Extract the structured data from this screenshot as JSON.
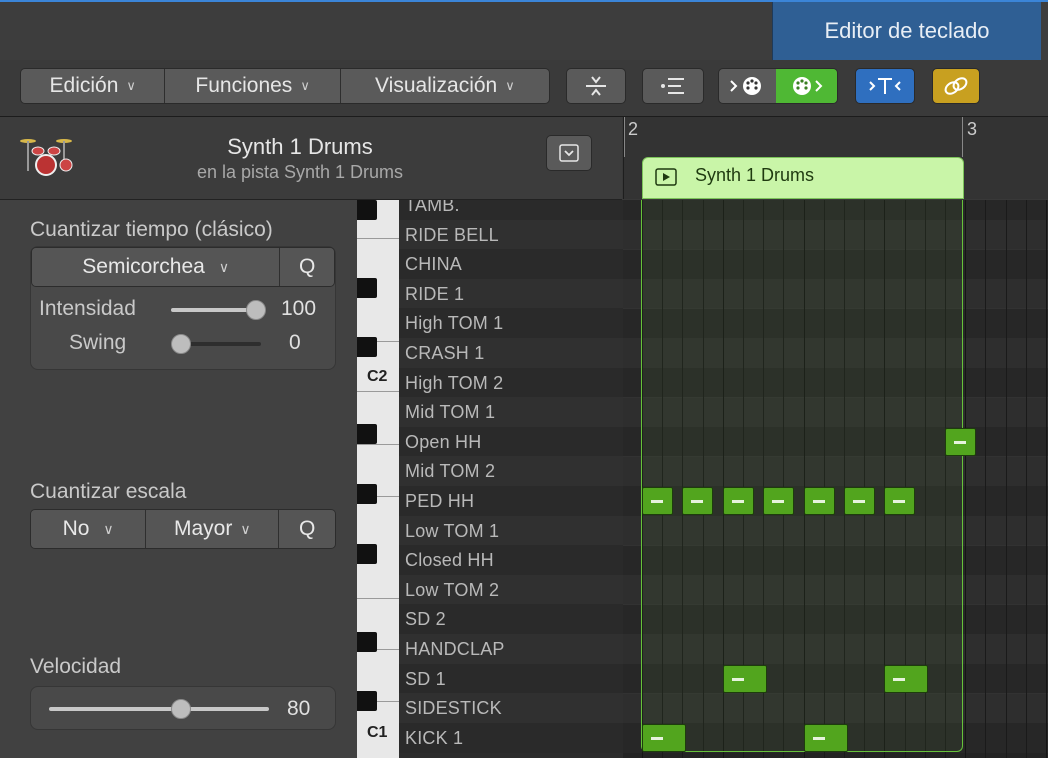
{
  "tabs": {
    "keyboard_editor": "Editor de teclado"
  },
  "toolbar": {
    "menus": [
      {
        "label": "Edición",
        "chevron": "∨"
      },
      {
        "label": "Funciones",
        "chevron": "∨"
      },
      {
        "label": "Visualización",
        "chevron": "∨"
      }
    ],
    "icons": [
      "collapse-vertical-icon",
      "filter-list-icon",
      "midi-in-icon",
      "midi-out-icon",
      "catch-playhead-icon",
      "link-icon"
    ],
    "midi_out_active_color": "#4fb834",
    "catch_color": "#2f6fbf",
    "link_color": "#c8a020"
  },
  "track": {
    "name": "Synth 1 Drums",
    "subtitle": "en la pista Synth 1 Drums",
    "icon": "drum-kit-icon"
  },
  "quantize": {
    "title": "Cuantizar tiempo (clásico)",
    "value": "Semicorchea",
    "q_label": "Q",
    "strength_label": "Intensidad",
    "strength_value": "100",
    "strength_level": 1.0,
    "swing_label": "Swing",
    "swing_value": "0",
    "swing_level": 0.0
  },
  "scale_quantize": {
    "title": "Cuantizar escala",
    "root_value": "No",
    "scale_value": "Mayor",
    "q_label": "Q"
  },
  "velocity": {
    "title": "Velocidad",
    "value": "80",
    "level": 0.63
  },
  "ruler": {
    "bar_start": "2",
    "bar_end": "3"
  },
  "region": {
    "name": "Synth 1 Drums",
    "color": "#c9f5a8"
  },
  "piano": {
    "c2_label": "C2",
    "c1_label": "C1"
  },
  "drum_lanes": [
    "TAMB.",
    "RIDE BELL",
    "CHINA",
    "RIDE 1",
    "High TOM 1",
    "CRASH 1",
    "High TOM 2",
    "Mid TOM 1",
    "Open HH",
    "Mid TOM 2",
    "PED HH",
    "Low TOM 1",
    "Closed HH",
    "Low TOM 2",
    "SD 2",
    "HANDCLAP",
    "SD 1",
    "SIDESTICK",
    "KICK 1"
  ],
  "notes": [
    {
      "lane": "Open HH",
      "step": 15,
      "length_steps": 1
    },
    {
      "lane": "PED HH",
      "step": 0,
      "length_steps": 1
    },
    {
      "lane": "PED HH",
      "step": 2,
      "length_steps": 1
    },
    {
      "lane": "PED HH",
      "step": 4,
      "length_steps": 1
    },
    {
      "lane": "PED HH",
      "step": 6,
      "length_steps": 1
    },
    {
      "lane": "PED HH",
      "step": 8,
      "length_steps": 1
    },
    {
      "lane": "PED HH",
      "step": 10,
      "length_steps": 1
    },
    {
      "lane": "PED HH",
      "step": 12,
      "length_steps": 1
    },
    {
      "lane": "SD 1",
      "step": 4,
      "length_steps": 2
    },
    {
      "lane": "SD 1",
      "step": 12,
      "length_steps": 2
    },
    {
      "lane": "KICK 1",
      "step": 0,
      "length_steps": 2
    },
    {
      "lane": "KICK 1",
      "step": 8,
      "length_steps": 2
    }
  ]
}
